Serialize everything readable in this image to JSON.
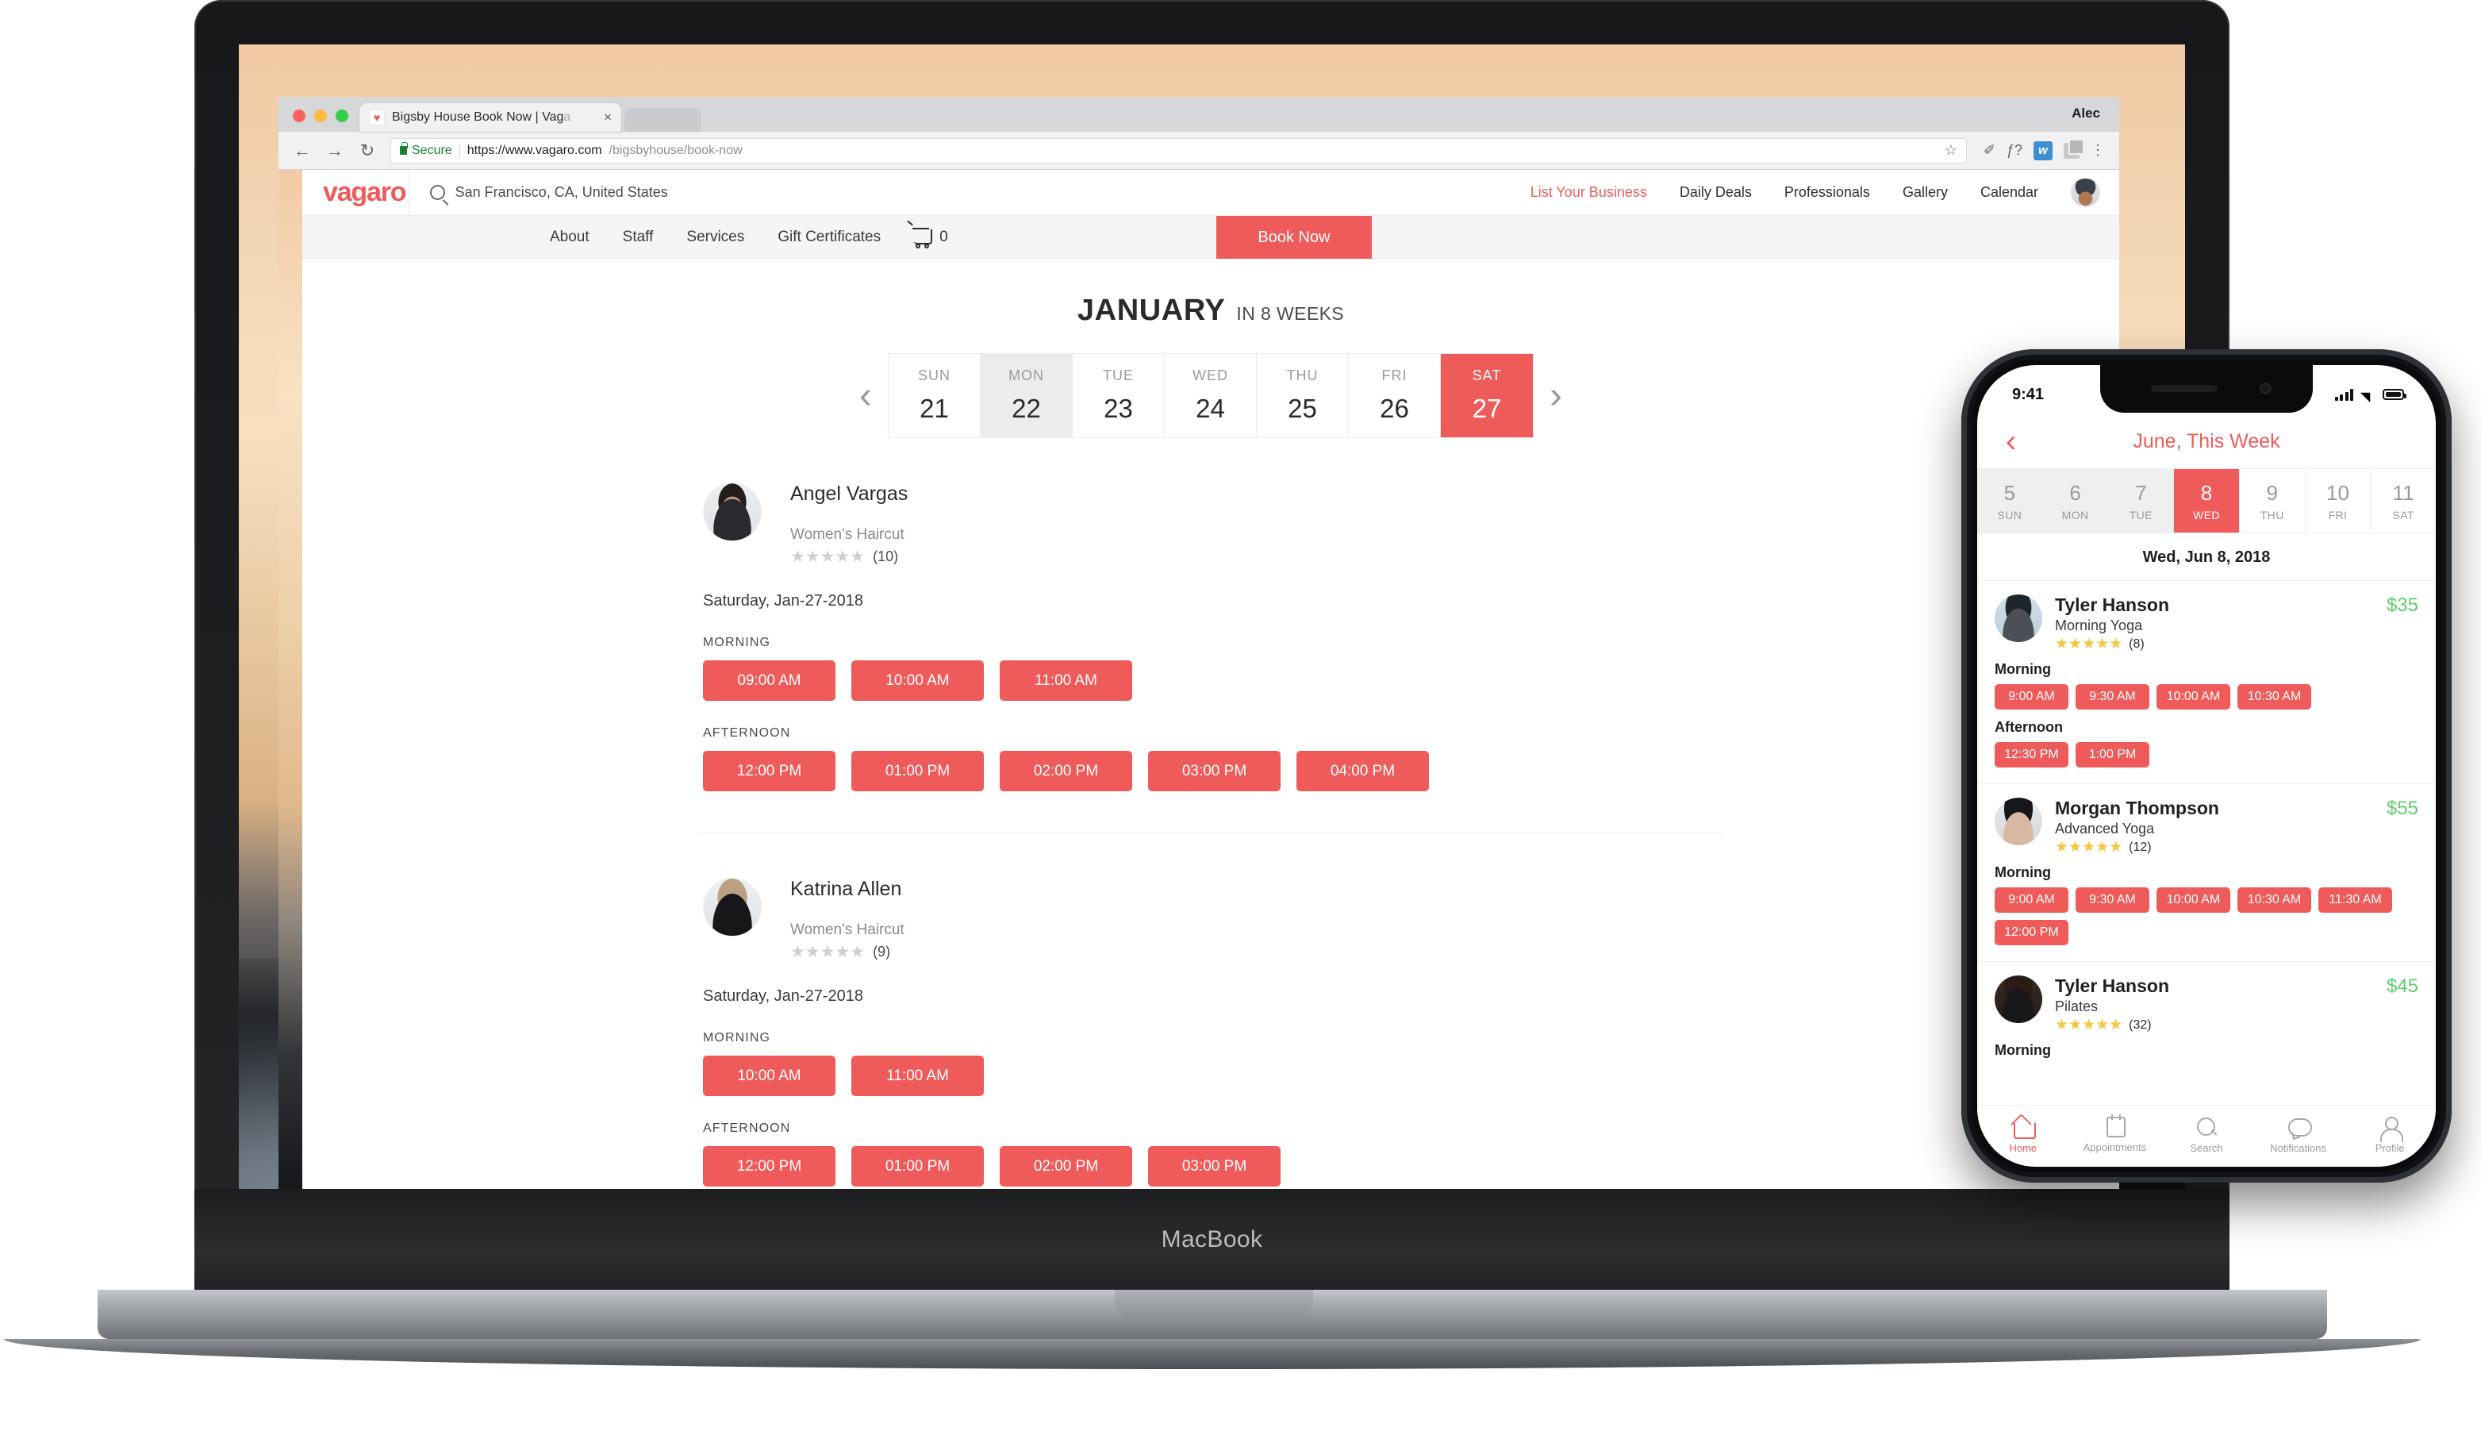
{
  "browser": {
    "tab_title": "Bigsby House Book Now | Vag",
    "tab_title_dim": "a",
    "close_label": "×",
    "favicon_glyph": "♥",
    "window_user": "Alec",
    "secure_label": "Secure",
    "url_domain": "https://www.vagaro.com",
    "url_path": "/bigsbyhouse/book-now",
    "back_glyph": "←",
    "forward_glyph": "→",
    "reload_glyph": "↻",
    "star_glyph": "☆",
    "eyedropper_glyph": "✐",
    "fontawesome_glyph": "ƒ?",
    "webflow_glyph": "w",
    "menu_glyph": "⋮"
  },
  "device": {
    "macbook_label": "MacBook"
  },
  "site": {
    "logo": "vagaro",
    "search_value": "San Francisco, CA, United States",
    "search_placeholder": "San Francisco, CA, United States",
    "nav_links": [
      "List Your Business",
      "Daily Deals",
      "Professionals",
      "Gallery",
      "Calendar"
    ],
    "subnav": [
      "About",
      "Staff",
      "Services",
      "Gift Certificates"
    ],
    "cart_count": "0",
    "book_now": "Book Now"
  },
  "calendar": {
    "month": "JANUARY",
    "subtitle": "IN 8 WEEKS",
    "prev_glyph": "‹",
    "next_glyph": "›",
    "days": [
      {
        "weekday": "SUN",
        "number": "21",
        "state": "normal"
      },
      {
        "weekday": "MON",
        "number": "22",
        "state": "muted"
      },
      {
        "weekday": "TUE",
        "number": "23",
        "state": "normal"
      },
      {
        "weekday": "WED",
        "number": "24",
        "state": "normal"
      },
      {
        "weekday": "THU",
        "number": "25",
        "state": "normal"
      },
      {
        "weekday": "FRI",
        "number": "26",
        "state": "normal"
      },
      {
        "weekday": "SAT",
        "number": "27",
        "state": "selected"
      }
    ]
  },
  "providers": [
    {
      "name": "Angel Vargas",
      "service": "Women's Haircut",
      "stars": "★★★★★",
      "review_count": "(10)",
      "date": "Saturday, Jan-27-2018",
      "morning_label": "MORNING",
      "morning_slots": [
        "09:00 AM",
        "10:00 AM",
        "11:00 AM"
      ],
      "afternoon_label": "AFTERNOON",
      "afternoon_slots": [
        "12:00 PM",
        "01:00 PM",
        "02:00 PM",
        "03:00 PM",
        "04:00 PM"
      ]
    },
    {
      "name": "Katrina Allen",
      "service": "Women's Haircut",
      "stars": "★★★★★",
      "review_count": "(9)",
      "date": "Saturday, Jan-27-2018",
      "morning_label": "MORNING",
      "morning_slots": [
        "10:00 AM",
        "11:00 AM"
      ],
      "afternoon_label": "AFTERNOON",
      "afternoon_slots": [
        "12:00 PM",
        "01:00 PM",
        "02:00 PM",
        "03:00 PM"
      ]
    }
  ],
  "phone": {
    "status_time": "9:41",
    "back_glyph": "‹",
    "title": "June, This Week",
    "days": [
      {
        "number": "5",
        "weekday": "SUN",
        "state": "past"
      },
      {
        "number": "6",
        "weekday": "MON",
        "state": "past"
      },
      {
        "number": "7",
        "weekday": "TUE",
        "state": "past"
      },
      {
        "number": "8",
        "weekday": "WED",
        "state": "selected"
      },
      {
        "number": "9",
        "weekday": "THU",
        "state": "normal"
      },
      {
        "number": "10",
        "weekday": "FRI",
        "state": "normal"
      },
      {
        "number": "11",
        "weekday": "SAT",
        "state": "normal"
      }
    ],
    "date_header": "Wed, Jun 8, 2018",
    "cards": [
      {
        "name": "Tyler Hanson",
        "service": "Morning Yoga",
        "stars": "★★★★★",
        "review_count": "(8)",
        "price": "$35",
        "morning_label": "Morning",
        "morning_slots": [
          "9:00 AM",
          "9:30 AM",
          "10:00 AM",
          "10:30 AM"
        ],
        "afternoon_label": "Afternoon",
        "afternoon_slots": [
          "12:30 PM",
          "1:00 PM"
        ]
      },
      {
        "name": "Morgan Thompson",
        "service": "Advanced Yoga",
        "stars": "★★★★★",
        "review_count": "(12)",
        "price": "$55",
        "morning_label": "Morning",
        "morning_slots": [
          "9:00 AM",
          "9:30 AM",
          "10:00 AM",
          "10:30 AM",
          "11:30 AM",
          "12:00 PM"
        ],
        "afternoon_label": "",
        "afternoon_slots": []
      },
      {
        "name": "Tyler Hanson",
        "service": "Pilates",
        "stars": "★★★★★",
        "review_count": "(32)",
        "price": "$45",
        "morning_label": "Morning",
        "morning_slots": [],
        "afternoon_label": "",
        "afternoon_slots": []
      }
    ],
    "tabbar": [
      {
        "label": "Home",
        "icon": "home-icon",
        "active": true
      },
      {
        "label": "Appointments",
        "icon": "calendar-icon",
        "active": false
      },
      {
        "label": "Search",
        "icon": "search-icon",
        "active": false
      },
      {
        "label": "Notifications",
        "icon": "chat-bubble-icon",
        "active": false
      },
      {
        "label": "Profile",
        "icon": "user-icon",
        "active": false
      }
    ]
  },
  "colors": {
    "accent": "#ef5b5b",
    "price_green": "#5fcc6a",
    "star_gold": "#f6c640"
  }
}
